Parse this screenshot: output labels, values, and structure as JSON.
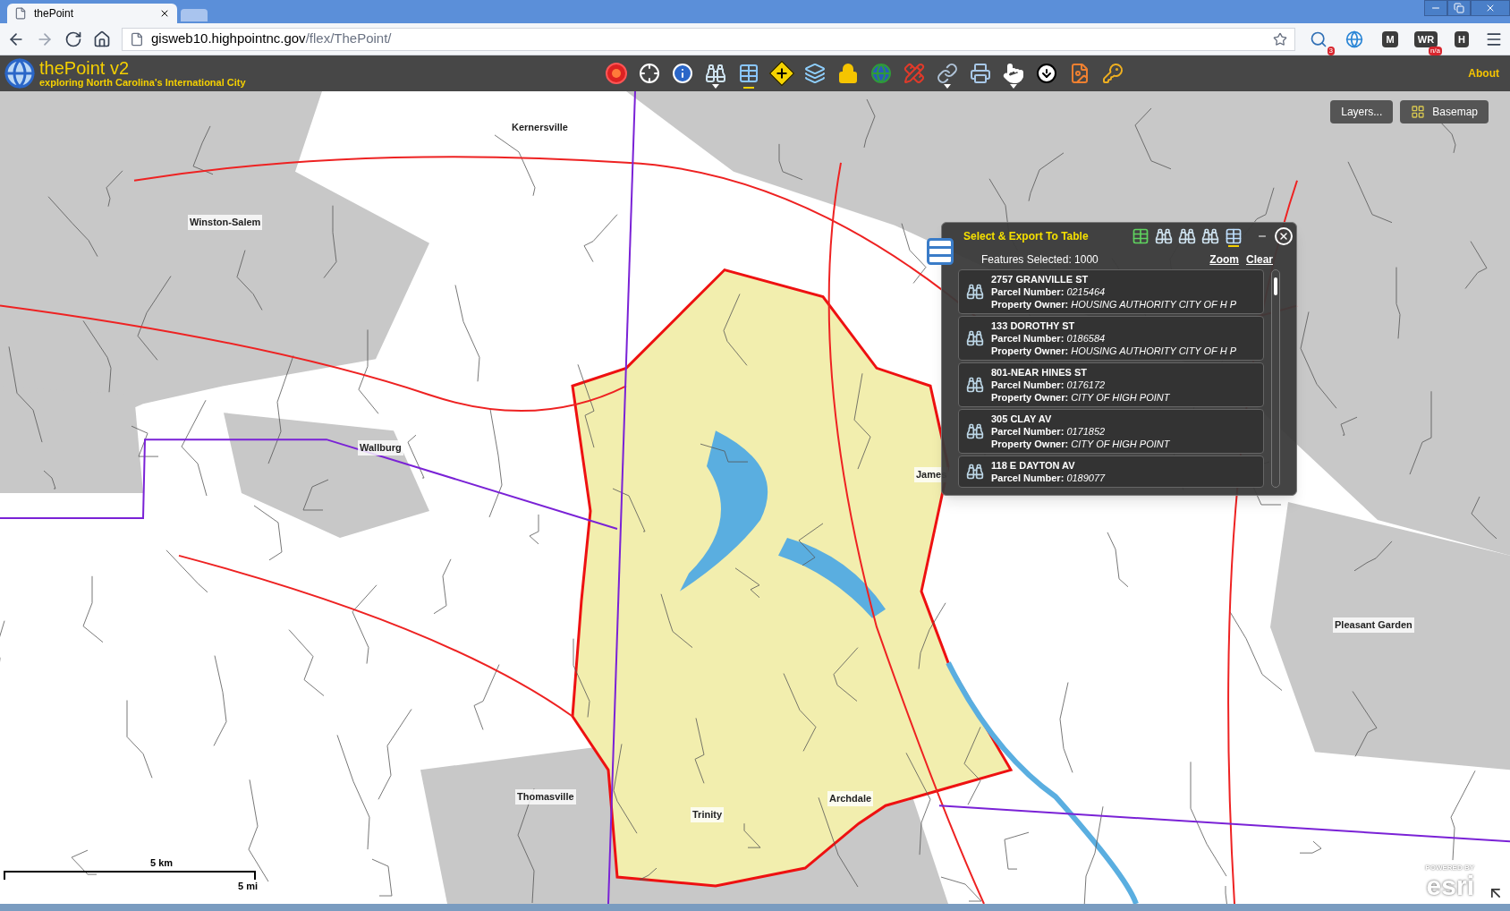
{
  "browser": {
    "tab_title": "thePoint",
    "url_host": "gisweb10.highpointnc.gov",
    "url_path": "/flex/ThePoint/",
    "extensions": [
      {
        "kind": "search",
        "badge": "3"
      },
      {
        "kind": "globe"
      },
      {
        "kind": "letter",
        "label": "M"
      },
      {
        "kind": "letter",
        "label": "WR",
        "badge": "n/a"
      },
      {
        "kind": "letter",
        "label": "H"
      }
    ]
  },
  "app": {
    "title": "thePoint v2",
    "subtitle": "exploring North Carolina's International City",
    "about": "About",
    "tools": [
      {
        "kind": "target",
        "selected": false,
        "menu": false
      },
      {
        "kind": "crosshair",
        "selected": false,
        "menu": false
      },
      {
        "kind": "info",
        "selected": false,
        "menu": false
      },
      {
        "kind": "binoculars",
        "selected": false,
        "menu": true
      },
      {
        "kind": "table",
        "selected": true,
        "menu": false
      },
      {
        "kind": "diamond",
        "selected": false,
        "menu": false
      },
      {
        "kind": "layers",
        "selected": false,
        "menu": false
      },
      {
        "kind": "lock",
        "selected": false,
        "menu": false
      },
      {
        "kind": "globe",
        "selected": false,
        "menu": false
      },
      {
        "kind": "draw",
        "selected": false,
        "menu": false
      },
      {
        "kind": "link",
        "selected": false,
        "menu": true
      },
      {
        "kind": "print",
        "selected": false,
        "menu": false
      },
      {
        "kind": "hand",
        "selected": false,
        "menu": true
      },
      {
        "kind": "download",
        "selected": false,
        "menu": false
      },
      {
        "kind": "image",
        "selected": false,
        "menu": false
      },
      {
        "kind": "key",
        "selected": false,
        "menu": false
      }
    ]
  },
  "map": {
    "buttons": [
      "Layers...",
      "Basemap"
    ],
    "places": [
      {
        "name": "Kernersville"
      },
      {
        "name": "Winston-Salem"
      },
      {
        "name": "Wallburg"
      },
      {
        "name": "James"
      },
      {
        "name": "Pleasant Garden"
      },
      {
        "name": "Thomasville"
      },
      {
        "name": "Archdale"
      },
      {
        "name": "Trinity"
      }
    ],
    "scale": {
      "km": "5 km",
      "mi": "5 mi"
    },
    "attribution": "POWERED BY",
    "logo": "esri"
  },
  "panel": {
    "title": "Select & Export To Table",
    "tools": [
      {
        "kind": "table",
        "selected": false
      },
      {
        "kind": "binoculars",
        "selected": false
      },
      {
        "kind": "binoculars",
        "selected": false
      },
      {
        "kind": "binoculars",
        "selected": false
      },
      {
        "kind": "grid",
        "selected": true
      }
    ],
    "count": "Features Selected: 1000",
    "links": [
      "Zoom",
      "Clear"
    ],
    "results": [
      {
        "address": "2757 GRANVILLE ST",
        "parcel_label": "Parcel Number:",
        "parcel": "0215464",
        "owner_label": "Property Owner:",
        "owner": "HOUSING AUTHORITY CITY OF H P"
      },
      {
        "address": "133 DOROTHY ST",
        "parcel_label": "Parcel Number:",
        "parcel": "0186584",
        "owner_label": "Property Owner:",
        "owner": "HOUSING AUTHORITY CITY OF H P"
      },
      {
        "address": "801-NEAR HINES ST",
        "parcel_label": "Parcel Number:",
        "parcel": "0176172",
        "owner_label": "Property Owner:",
        "owner": "CITY OF HIGH POINT"
      },
      {
        "address": "305 CLAY AV",
        "parcel_label": "Parcel Number:",
        "parcel": "0171852",
        "owner_label": "Property Owner:",
        "owner": "CITY OF HIGH POINT"
      },
      {
        "address": "118 E DAYTON AV",
        "parcel_label": "Parcel Number:",
        "parcel": "0189077"
      }
    ]
  }
}
